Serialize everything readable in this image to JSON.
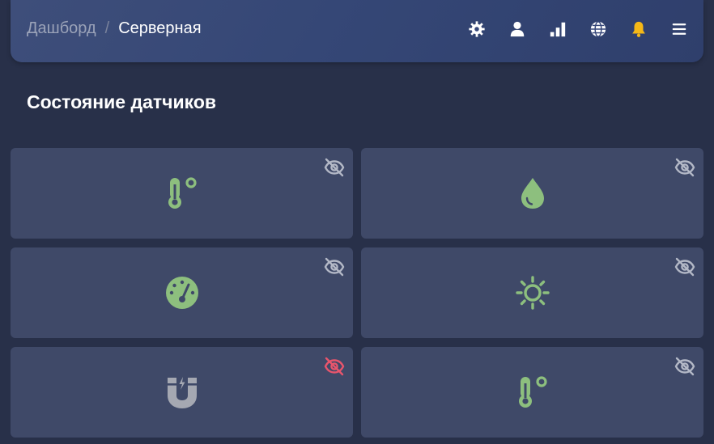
{
  "header": {
    "breadcrumb": {
      "parent": "Дашборд",
      "separator": "/",
      "current": "Серверная"
    },
    "toolbar": [
      {
        "icon": "gear-icon",
        "color": "#ffffff"
      },
      {
        "icon": "user-icon",
        "color": "#ffffff"
      },
      {
        "icon": "signal-bars-icon",
        "color": "#ffffff"
      },
      {
        "icon": "globe-icon",
        "color": "#ffffff"
      },
      {
        "icon": "bell-icon",
        "color": "#f5b817"
      },
      {
        "icon": "menu-icon",
        "color": "#ffffff"
      }
    ]
  },
  "main": {
    "title": "Состояние датчиков",
    "sensors": [
      {
        "icon": "thermometer-icon",
        "icon_color": "#8dbf7e",
        "visibility_icon": "eye-slash-icon",
        "visibility_color": "#b3b8c6"
      },
      {
        "icon": "water-drop-icon",
        "icon_color": "#8dbf7e",
        "visibility_icon": "eye-slash-icon",
        "visibility_color": "#b3b8c6"
      },
      {
        "icon": "gauge-icon",
        "icon_color": "#8dbf7e",
        "visibility_icon": "eye-slash-icon",
        "visibility_color": "#b3b8c6"
      },
      {
        "icon": "sun-icon",
        "icon_color": "#8dbf7e",
        "visibility_icon": "eye-slash-icon",
        "visibility_color": "#b3b8c6"
      },
      {
        "icon": "magnet-icon",
        "icon_color": "#a5a8b2",
        "visibility_icon": "eye-slash-icon",
        "visibility_color": "#e8556c"
      },
      {
        "icon": "thermometer-icon",
        "icon_color": "#8dbf7e",
        "visibility_icon": "eye-slash-icon",
        "visibility_color": "#b3b8c6"
      }
    ]
  }
}
